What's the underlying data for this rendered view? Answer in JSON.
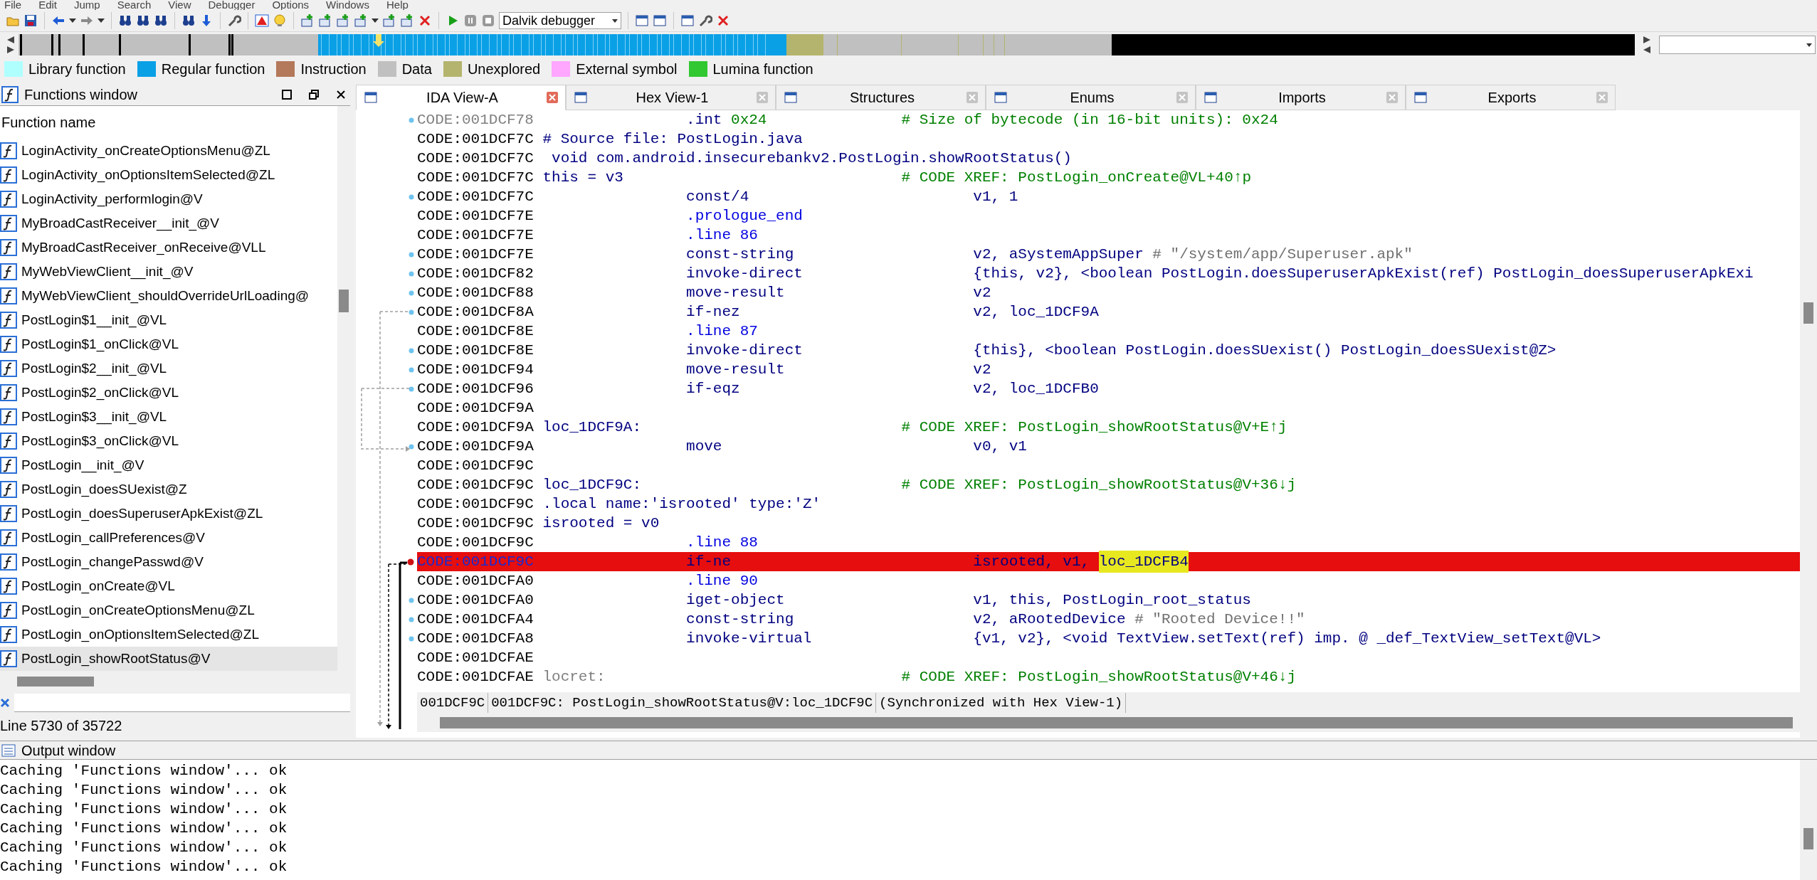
{
  "menu": [
    "File",
    "Edit",
    "Jump",
    "Search",
    "View",
    "Debugger",
    "Options",
    "Windows",
    "Help"
  ],
  "toolbar": {
    "debugger": "Dalvik debugger"
  },
  "legend": [
    {
      "label": "Library function",
      "color": "#b0ffff"
    },
    {
      "label": "Regular function",
      "color": "#0aa0e6"
    },
    {
      "label": "Instruction",
      "color": "#b4785a"
    },
    {
      "label": "Data",
      "color": "#c0c0c0"
    },
    {
      "label": "Unexplored",
      "color": "#b4b46e"
    },
    {
      "label": "External symbol",
      "color": "#ffa6ff"
    },
    {
      "label": "Lumina function",
      "color": "#32c832"
    }
  ],
  "functions_window": {
    "title": "Functions window",
    "column": "Function name",
    "items": [
      {
        "name": "LoginActivity_onCreateOptionsMenu@ZL",
        "selected": false
      },
      {
        "name": "LoginActivity_onOptionsItemSelected@ZL",
        "selected": false
      },
      {
        "name": "LoginActivity_performlogin@V",
        "selected": false
      },
      {
        "name": "MyBroadCastReceiver__init_@V",
        "selected": false
      },
      {
        "name": "MyBroadCastReceiver_onReceive@VLL",
        "selected": false
      },
      {
        "name": "MyWebViewClient__init_@V",
        "selected": false
      },
      {
        "name": "MyWebViewClient_shouldOverrideUrlLoading@",
        "selected": false
      },
      {
        "name": "PostLogin$1__init_@VL",
        "selected": false
      },
      {
        "name": "PostLogin$1_onClick@VL",
        "selected": false
      },
      {
        "name": "PostLogin$2__init_@VL",
        "selected": false
      },
      {
        "name": "PostLogin$2_onClick@VL",
        "selected": false
      },
      {
        "name": "PostLogin$3__init_@VL",
        "selected": false
      },
      {
        "name": "PostLogin$3_onClick@VL",
        "selected": false
      },
      {
        "name": "PostLogin__init_@V",
        "selected": false
      },
      {
        "name": "PostLogin_doesSUexist@Z",
        "selected": false
      },
      {
        "name": "PostLogin_doesSuperuserApkExist@ZL",
        "selected": false
      },
      {
        "name": "PostLogin_callPreferences@V",
        "selected": false
      },
      {
        "name": "PostLogin_changePasswd@V",
        "selected": false
      },
      {
        "name": "PostLogin_onCreate@VL",
        "selected": false
      },
      {
        "name": "PostLogin_onCreateOptionsMenu@ZL",
        "selected": false
      },
      {
        "name": "PostLogin_onOptionsItemSelected@ZL",
        "selected": false
      },
      {
        "name": "PostLogin_showRootStatus@V",
        "selected": true
      }
    ],
    "line_status": "Line 5730 of 35722"
  },
  "tabs": [
    {
      "label": "IDA View-A",
      "selected": true
    },
    {
      "label": "Hex View-1",
      "selected": false
    },
    {
      "label": "Structures",
      "selected": false
    },
    {
      "label": "Enums",
      "selected": false
    },
    {
      "label": "Imports",
      "selected": false
    },
    {
      "label": "Exports",
      "selected": false
    }
  ],
  "lines": [
    {
      "address": "CODE:001DCF78",
      "kind": "data",
      "mnemonic": ".int",
      "operands": "0x24",
      "comment": "# Size of bytecode (in 16-bit units): 0x24",
      "dot": true,
      "breakpoint": false,
      "highlighted": false
    },
    {
      "address": "CODE:001DCF7C",
      "kind": "label",
      "label": "# Source file: PostLogin.java",
      "dot": false,
      "breakpoint": false,
      "highlighted": false
    },
    {
      "address": "CODE:001DCF7C",
      "kind": "label",
      "label": " void com.android.insecurebankv2.PostLogin.showRootStatus()",
      "dot": false,
      "breakpoint": false,
      "highlighted": false
    },
    {
      "address": "CODE:001DCF7C",
      "kind": "label",
      "label": "this = v3",
      "comment": "# CODE XREF: PostLogin_onCreate@VL+40↑p",
      "dot": false,
      "breakpoint": false,
      "highlighted": false
    },
    {
      "address": "CODE:001DCF7C",
      "kind": "instruction",
      "mnemonic": "const/4",
      "operands": "v1, 1",
      "dot": true,
      "breakpoint": false,
      "highlighted": false
    },
    {
      "address": "CODE:001DCF7E",
      "kind": "directive",
      "mnemonic": ".prologue_end",
      "dot": false,
      "breakpoint": false,
      "highlighted": false
    },
    {
      "address": "CODE:001DCF7E",
      "kind": "directive",
      "mnemonic": ".line 86",
      "dot": false,
      "breakpoint": false,
      "highlighted": false
    },
    {
      "address": "CODE:001DCF7E",
      "kind": "instruction",
      "mnemonic": "const-string",
      "operands": "v2, aSystemAppSuper",
      "note": "# \"/system/app/Superuser.apk\"",
      "dot": true,
      "breakpoint": false,
      "highlighted": false
    },
    {
      "address": "CODE:001DCF82",
      "kind": "instruction",
      "mnemonic": "invoke-direct",
      "operands": "{this, v2}, <boolean PostLogin.doesSuperuserApkExist(ref) PostLogin_doesSuperuserApkExi",
      "dot": true,
      "breakpoint": false,
      "highlighted": false
    },
    {
      "address": "CODE:001DCF88",
      "kind": "instruction",
      "mnemonic": "move-result",
      "operands": "v2",
      "dot": true,
      "breakpoint": false,
      "highlighted": false
    },
    {
      "address": "CODE:001DCF8A",
      "kind": "instruction",
      "mnemonic": "if-nez",
      "operands": "v2, loc_1DCF9A",
      "dot": true,
      "breakpoint": false,
      "highlighted": false
    },
    {
      "address": "CODE:001DCF8E",
      "kind": "directive",
      "mnemonic": ".line 87",
      "dot": false,
      "breakpoint": false,
      "highlighted": false
    },
    {
      "address": "CODE:001DCF8E",
      "kind": "instruction",
      "mnemonic": "invoke-direct",
      "operands": "{this}, <boolean PostLogin.doesSUexist() PostLogin_doesSUexist@Z>",
      "dot": true,
      "breakpoint": false,
      "highlighted": false
    },
    {
      "address": "CODE:001DCF94",
      "kind": "instruction",
      "mnemonic": "move-result",
      "operands": "v2",
      "dot": true,
      "breakpoint": false,
      "highlighted": false
    },
    {
      "address": "CODE:001DCF96",
      "kind": "instruction",
      "mnemonic": "if-eqz",
      "operands": "v2, loc_1DCFB0",
      "dot": true,
      "breakpoint": false,
      "highlighted": false
    },
    {
      "address": "CODE:001DCF9A",
      "kind": "blank",
      "dot": false,
      "breakpoint": false,
      "highlighted": false
    },
    {
      "address": "CODE:001DCF9A",
      "kind": "label",
      "label": "loc_1DCF9A:",
      "comment": "# CODE XREF: PostLogin_showRootStatus@V+E↑j",
      "dot": false,
      "breakpoint": false,
      "highlighted": false
    },
    {
      "address": "CODE:001DCF9A",
      "kind": "instruction",
      "mnemonic": "move",
      "operands": "v0, v1",
      "dot": true,
      "breakpoint": false,
      "highlighted": false
    },
    {
      "address": "CODE:001DCF9C",
      "kind": "blank",
      "dot": false,
      "breakpoint": false,
      "highlighted": false
    },
    {
      "address": "CODE:001DCF9C",
      "kind": "label",
      "label": "loc_1DCF9C:",
      "comment": "# CODE XREF: PostLogin_showRootStatus@V+36↓j",
      "dot": false,
      "breakpoint": false,
      "highlighted": false
    },
    {
      "address": "CODE:001DCF9C",
      "kind": "label",
      "label": ".local name:'isrooted' type:'Z'",
      "dot": false,
      "breakpoint": false,
      "highlighted": false
    },
    {
      "address": "CODE:001DCF9C",
      "kind": "label",
      "label": "isrooted = v0",
      "dot": false,
      "breakpoint": false,
      "highlighted": false
    },
    {
      "address": "CODE:001DCF9C",
      "kind": "directive",
      "mnemonic": ".line 88",
      "dot": false,
      "breakpoint": false,
      "highlighted": false
    },
    {
      "address": "CODE:001DCF9C",
      "kind": "instruction",
      "mnemonic": "if-ne",
      "operands": "isrooted, v1, ",
      "selected_token": "loc_1DCFB4",
      "dot": false,
      "breakpoint": true,
      "highlighted": true
    },
    {
      "address": "CODE:001DCFA0",
      "kind": "directive",
      "mnemonic": ".line 90",
      "dot": false,
      "breakpoint": false,
      "highlighted": false
    },
    {
      "address": "CODE:001DCFA0",
      "kind": "instruction",
      "mnemonic": "iget-object",
      "operands": "v1, this, PostLogin_root_status",
      "dot": true,
      "breakpoint": false,
      "highlighted": false
    },
    {
      "address": "CODE:001DCFA4",
      "kind": "instruction",
      "mnemonic": "const-string",
      "operands": "v2, aRootedDevice",
      "note": "# \"Rooted Device!!\"",
      "dot": true,
      "breakpoint": false,
      "highlighted": false
    },
    {
      "address": "CODE:001DCFA8",
      "kind": "instruction",
      "mnemonic": "invoke-virtual",
      "operands": "{v1, v2}, <void TextView.setText(ref) imp. @ _def_TextView_setText@VL>",
      "dot": true,
      "breakpoint": false,
      "highlighted": false
    },
    {
      "address": "CODE:001DCFAE",
      "kind": "blank",
      "dot": false,
      "breakpoint": false,
      "highlighted": false
    },
    {
      "address": "CODE:001DCFAE",
      "kind": "end_label",
      "label": "locret:",
      "comment": "# CODE XREF: PostLogin_showRootStatus@V+46↓j",
      "dot": false,
      "breakpoint": false,
      "highlighted": false
    }
  ],
  "view_status": {
    "offset": "001DCF9C",
    "location": "001DCF9C: PostLogin_showRootStatus@V:loc_1DCF9C",
    "sync": "(Synchronized with Hex View-1)"
  },
  "output_window": {
    "title": "Output window",
    "lines": [
      "Caching 'Functions window'... ok",
      "Caching 'Functions window'... ok",
      "Caching 'Functions window'... ok",
      "Caching 'Functions window'... ok",
      "Caching 'Functions window'... ok",
      "Caching 'Functions window'... ok"
    ]
  }
}
